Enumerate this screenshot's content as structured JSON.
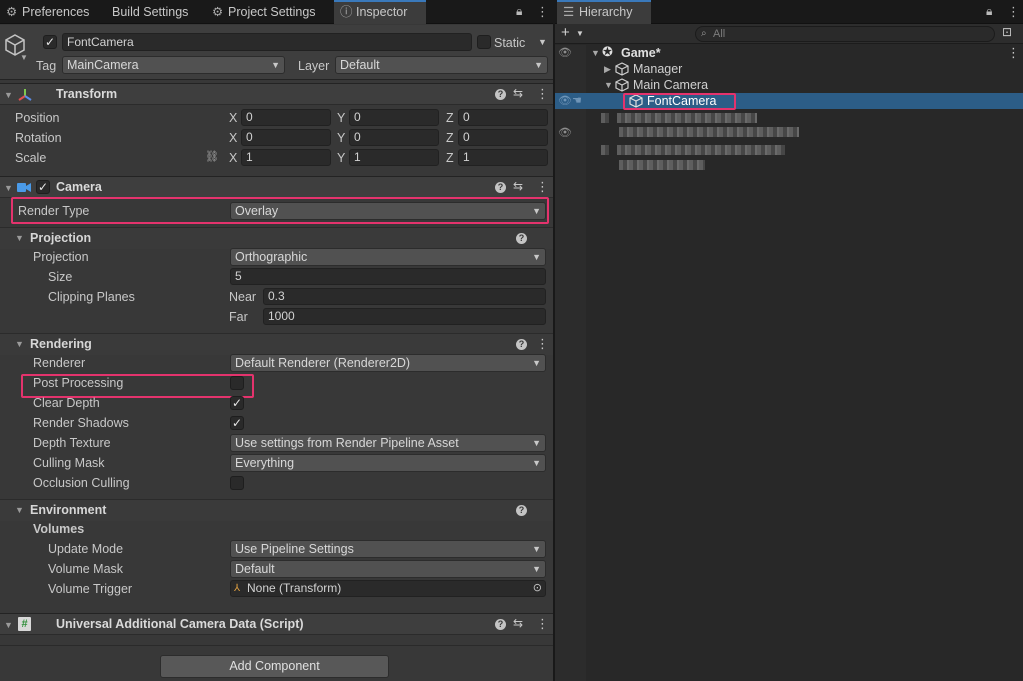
{
  "inspector_tabs": [
    {
      "label": "Preferences",
      "icon": "gear-icon"
    },
    {
      "label": "Build Settings"
    },
    {
      "label": "Project Settings",
      "icon": "gear-icon"
    },
    {
      "label": "Inspector",
      "icon": "info-icon"
    }
  ],
  "object": {
    "name": "FontCamera",
    "static_label": "Static",
    "tag_label": "Tag",
    "tag_value": "MainCamera",
    "layer_label": "Layer",
    "layer_value": "Default"
  },
  "transform": {
    "title": "Transform",
    "position_label": "Position",
    "rotation_label": "Rotation",
    "scale_label": "Scale",
    "axis_x": "X",
    "axis_y": "Y",
    "axis_z": "Z",
    "position": [
      "0",
      "0",
      "0"
    ],
    "rotation": [
      "0",
      "0",
      "0"
    ],
    "scale": [
      "1",
      "1",
      "1"
    ]
  },
  "camera": {
    "title": "Camera",
    "render_type_label": "Render Type",
    "render_type_value": "Overlay",
    "projection_section": "Projection",
    "projection_label": "Projection",
    "projection_value": "Orthographic",
    "size_label": "Size",
    "size_value": "5",
    "clipping_label": "Clipping Planes",
    "near_label": "Near",
    "near_value": "0.3",
    "far_label": "Far",
    "far_value": "1000",
    "rendering_section": "Rendering",
    "renderer_label": "Renderer",
    "renderer_value": "Default Renderer (Renderer2D)",
    "post_processing_label": "Post Processing",
    "post_processing_checked": false,
    "clear_depth_label": "Clear Depth",
    "clear_depth_checked": true,
    "render_shadows_label": "Render Shadows",
    "render_shadows_checked": true,
    "depth_texture_label": "Depth Texture",
    "depth_texture_value": "Use settings from Render Pipeline Asset",
    "culling_mask_label": "Culling Mask",
    "culling_mask_value": "Everything",
    "occlusion_label": "Occlusion Culling",
    "occlusion_checked": false,
    "environment_section": "Environment",
    "volumes_label": "Volumes",
    "update_mode_label": "Update Mode",
    "update_mode_value": "Use Pipeline Settings",
    "volume_mask_label": "Volume Mask",
    "volume_mask_value": "Default",
    "volume_trigger_label": "Volume Trigger",
    "volume_trigger_value": "None (Transform)"
  },
  "additional_data": {
    "title": "Universal Additional Camera Data (Script)"
  },
  "add_component_label": "Add Component",
  "hierarchy": {
    "tab_label": "Hierarchy",
    "search_placeholder": "All",
    "root": "Game*",
    "items": [
      "Manager",
      "Main Camera",
      "FontCamera"
    ]
  },
  "colors": {
    "accent": "#3a79bb",
    "highlight": "#e4336d",
    "selection": "#2c5d87"
  }
}
